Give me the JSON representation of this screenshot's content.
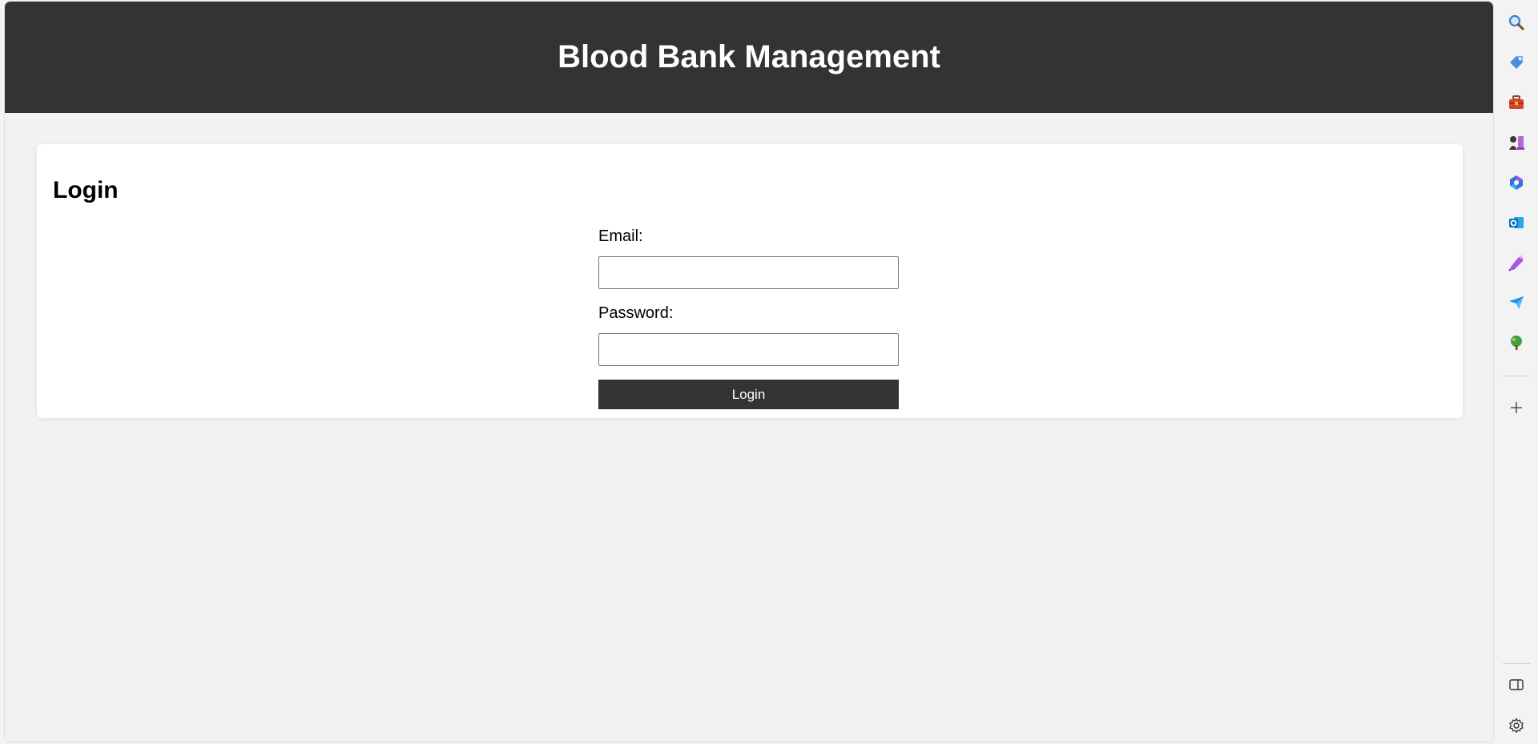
{
  "header": {
    "title": "Blood Bank Management"
  },
  "login": {
    "heading": "Login",
    "email_label": "Email:",
    "email_value": "",
    "password_label": "Password:",
    "password_value": "",
    "submit_label": "Login"
  },
  "sidebar": {
    "icons": [
      "search-icon",
      "tag-icon",
      "toolbox-icon",
      "chess-icon",
      "copilot-icon",
      "outlook-icon",
      "magnet-icon",
      "send-icon",
      "tree-icon"
    ],
    "add_icon": "plus-icon",
    "bottom_icons": [
      "split-view-icon",
      "settings-icon"
    ]
  },
  "colors": {
    "header_bg": "#333333",
    "button_bg": "#333333",
    "page_bg": "#f2f2f2",
    "card_bg": "#ffffff"
  }
}
